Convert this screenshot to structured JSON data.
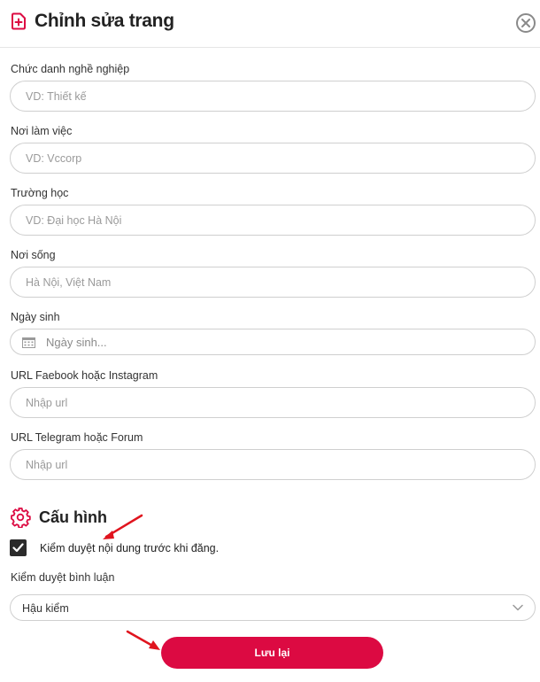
{
  "header": {
    "title": "Chỉnh sửa trang",
    "icon": "document-plus-icon",
    "close_icon": "close-circle-icon"
  },
  "fields": [
    {
      "label": "Chức danh nghề nghiệp",
      "placeholder": "VD: Thiết kế",
      "value": ""
    },
    {
      "label": "Nơi làm việc",
      "placeholder": "VD: Vccorp",
      "value": ""
    },
    {
      "label": "Trường học",
      "placeholder": "VD: Đại học Hà Nội",
      "value": ""
    },
    {
      "label": "Nơi sống",
      "placeholder": "Hà Nội, Việt Nam",
      "value": ""
    },
    {
      "label": "Ngày sinh",
      "placeholder": "Ngày sinh...",
      "value": ""
    },
    {
      "label": "URL Faebook hoặc Instagram",
      "placeholder": "Nhập url",
      "value": ""
    },
    {
      "label": "URL Telegram hoặc Forum",
      "placeholder": "Nhập url",
      "value": ""
    }
  ],
  "config": {
    "title": "Cấu hình",
    "icon": "gear-icon",
    "moderate_checkbox_label": "Kiểm duyệt nội dung trước khi đăng.",
    "moderate_checked": true,
    "comment_label": "Kiểm duyệt bình luận",
    "comment_value": "Hậu kiểm"
  },
  "save_label": "Lưu lại",
  "colors": {
    "accent": "#dc0a42",
    "annotation_arrow": "#e0141e",
    "border": "#cfcfcf",
    "checkbox": "#2b2b2b"
  }
}
